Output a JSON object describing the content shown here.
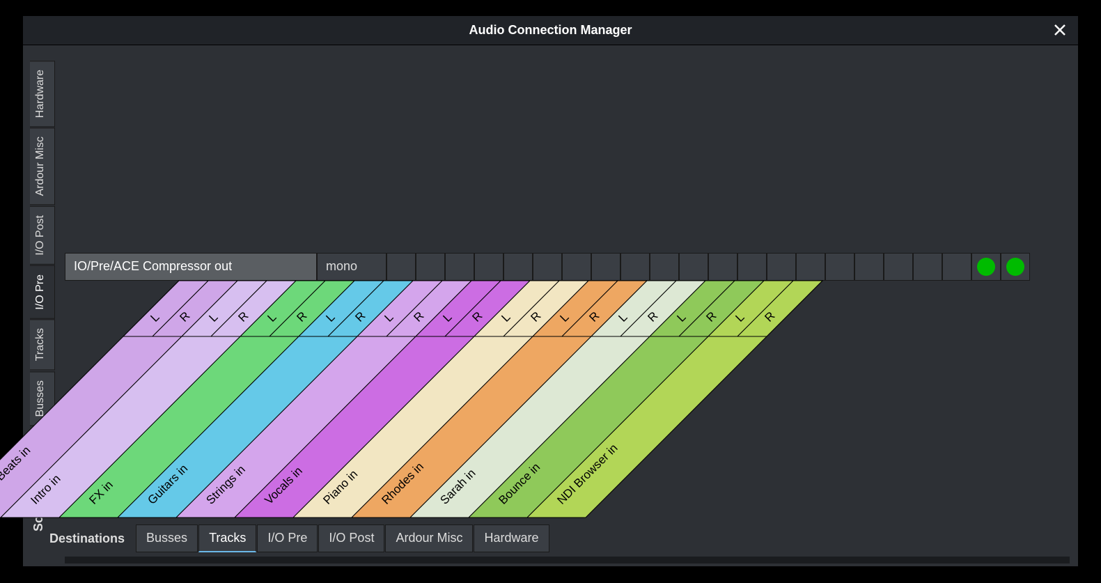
{
  "window": {
    "title": "Audio Connection Manager"
  },
  "sources_axis_label": "Sources",
  "destinations_axis_label": "Destinations",
  "source_tabs": [
    {
      "id": "hardware",
      "label": "Hardware",
      "active": false
    },
    {
      "id": "ardour-misc",
      "label": "Ardour Misc",
      "active": false
    },
    {
      "id": "io-post",
      "label": "I/O Post",
      "active": false
    },
    {
      "id": "io-pre",
      "label": "I/O Pre",
      "active": true
    },
    {
      "id": "tracks",
      "label": "Tracks",
      "active": false
    },
    {
      "id": "busses",
      "label": "Busses",
      "active": false
    }
  ],
  "dest_tabs": [
    {
      "id": "busses",
      "label": "Busses",
      "active": false
    },
    {
      "id": "tracks",
      "label": "Tracks",
      "active": true
    },
    {
      "id": "io-pre",
      "label": "I/O Pre",
      "active": false
    },
    {
      "id": "io-post",
      "label": "I/O Post",
      "active": false
    },
    {
      "id": "ardour-misc",
      "label": "Ardour Misc",
      "active": false
    },
    {
      "id": "hardware",
      "label": "Hardware",
      "active": false
    }
  ],
  "source_row": {
    "name": "IO/Pre/ACE Compressor out",
    "channel": "mono"
  },
  "destinations": [
    {
      "id": "audio-beats",
      "label": "Audio Beats in",
      "color": "#cfa6e8",
      "channels": [
        "L",
        "R"
      ]
    },
    {
      "id": "intro",
      "label": "Intro in",
      "color": "#d7bff0",
      "channels": [
        "L",
        "R"
      ]
    },
    {
      "id": "fx",
      "label": "FX in",
      "color": "#6dd87a",
      "channels": [
        "L",
        "R"
      ]
    },
    {
      "id": "guitars",
      "label": "Guitars in",
      "color": "#65c9e8",
      "channels": [
        "L",
        "R"
      ]
    },
    {
      "id": "strings",
      "label": "Strings in",
      "color": "#d4a5ec",
      "channels": [
        "L",
        "R"
      ]
    },
    {
      "id": "vocals",
      "label": "Vocals in",
      "color": "#cc6de3",
      "channels": [
        "L",
        "R"
      ]
    },
    {
      "id": "piano",
      "label": "Piano in",
      "color": "#f2e6c2",
      "channels": [
        "L",
        "R"
      ]
    },
    {
      "id": "rhodes",
      "label": "Rhodes in",
      "color": "#eea762",
      "channels": [
        "L",
        "R"
      ]
    },
    {
      "id": "sarah",
      "label": "Sarah in",
      "color": "#dde8d4",
      "channels": [
        "L",
        "R"
      ]
    },
    {
      "id": "bounce",
      "label": "Bounce in",
      "color": "#8fc95a",
      "channels": [
        "L",
        "R"
      ]
    },
    {
      "id": "ndi-browser",
      "label": "NDI Browser in",
      "color": "#b2d657",
      "channels": [
        "L",
        "R"
      ]
    }
  ],
  "connections": [
    {
      "source": "IO/Pre/ACE Compressor out:mono",
      "dest": "NDI Browser in:L",
      "dest_index": 20
    },
    {
      "source": "IO/Pre/ACE Compressor out:mono",
      "dest": "NDI Browser in:R",
      "dest_index": 21
    }
  ],
  "matrix_cell_count": 22
}
